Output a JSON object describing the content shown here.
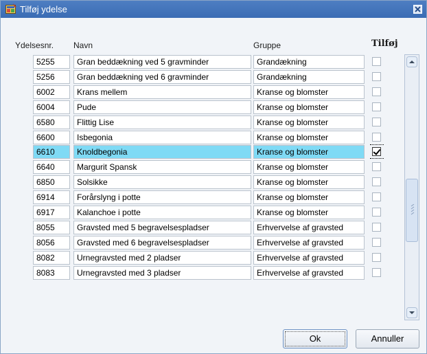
{
  "window": {
    "title": "Tilføj ydelse",
    "icon": "app-window-icon",
    "close_icon": "close-icon"
  },
  "columns": {
    "nr": "Ydelsesnr.",
    "navn": "Navn",
    "gruppe": "Gruppe",
    "tilfoj": "Tilføj"
  },
  "rows": [
    {
      "nr": "5255",
      "navn": "Gran beddækning ved 5 gravminder",
      "gruppe": "Grandækning",
      "checked": false,
      "selected": false
    },
    {
      "nr": "5256",
      "navn": "Gran beddækning ved 6 gravminder",
      "gruppe": "Grandækning",
      "checked": false,
      "selected": false
    },
    {
      "nr": "6002",
      "navn": "Krans mellem",
      "gruppe": "Kranse og blomster",
      "checked": false,
      "selected": false
    },
    {
      "nr": "6004",
      "navn": "Pude",
      "gruppe": "Kranse og blomster",
      "checked": false,
      "selected": false
    },
    {
      "nr": "6580",
      "navn": "Flittig Lise",
      "gruppe": "Kranse og blomster",
      "checked": false,
      "selected": false
    },
    {
      "nr": "6600",
      "navn": "Isbegonia",
      "gruppe": "Kranse og blomster",
      "checked": false,
      "selected": false
    },
    {
      "nr": "6610",
      "navn": "Knoldbegonia",
      "gruppe": "Kranse og blomster",
      "checked": true,
      "selected": true
    },
    {
      "nr": "6640",
      "navn": "Margurit Spansk",
      "gruppe": "Kranse og blomster",
      "checked": false,
      "selected": false
    },
    {
      "nr": "6850",
      "navn": "Solsikke",
      "gruppe": "Kranse og blomster",
      "checked": false,
      "selected": false
    },
    {
      "nr": "6914",
      "navn": "Forårslyng i potte",
      "gruppe": "Kranse og blomster",
      "checked": false,
      "selected": false
    },
    {
      "nr": "6917",
      "navn": "Kalanchoe i potte",
      "gruppe": "Kranse og blomster",
      "checked": false,
      "selected": false
    },
    {
      "nr": "8055",
      "navn": "Gravsted med 5 begravelsespladser",
      "gruppe": "Erhvervelse af gravsted",
      "checked": false,
      "selected": false
    },
    {
      "nr": "8056",
      "navn": "Gravsted med 6 begravelsespladser",
      "gruppe": "Erhvervelse af gravsted",
      "checked": false,
      "selected": false
    },
    {
      "nr": "8082",
      "navn": "Urnegravsted med 2 pladser",
      "gruppe": "Erhvervelse af gravsted",
      "checked": false,
      "selected": false
    },
    {
      "nr": "8083",
      "navn": "Urnegravsted med 3 pladser",
      "gruppe": "Erhvervelse af gravsted",
      "checked": false,
      "selected": false
    }
  ],
  "scrollbar": {
    "up_icon": "scroll-up-icon",
    "down_icon": "scroll-down-icon"
  },
  "buttons": {
    "ok": "Ok",
    "cancel": "Annuller"
  },
  "colors": {
    "titlebar": "#3a6cb4",
    "selected_row": "#7fdaf5"
  }
}
